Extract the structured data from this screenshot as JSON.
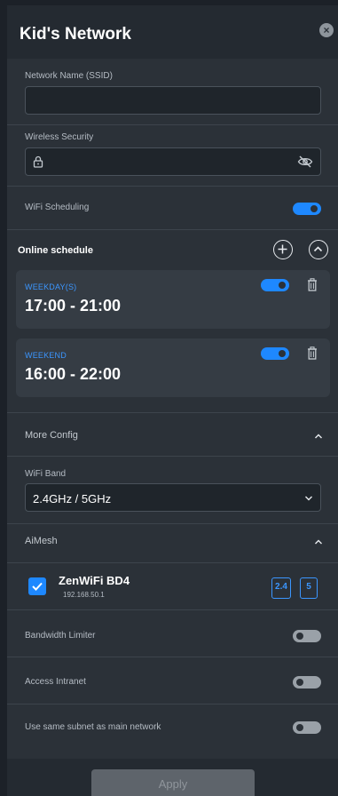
{
  "header": {
    "title": "Kid's Network",
    "close_glyph": "×"
  },
  "ssid": {
    "label": "Network Name (SSID)",
    "value": ""
  },
  "security": {
    "label": "Wireless Security",
    "value": ""
  },
  "wifi_scheduling": {
    "label": "WiFi Scheduling",
    "enabled": true
  },
  "online_schedule": {
    "title": "Online schedule",
    "items": [
      {
        "label": "WEEKDAY(S)",
        "time": "17:00 - 21:00",
        "enabled": true
      },
      {
        "label": "WEEKEND",
        "time": "16:00 - 22:00",
        "enabled": true
      }
    ]
  },
  "more_config": {
    "title": "More Config"
  },
  "wifi_band": {
    "label": "WiFi Band",
    "value": "2.4GHz / 5GHz"
  },
  "aimesh": {
    "title": "AiMesh",
    "node": {
      "name": "ZenWiFi BD4",
      "ip": "192.168.50.1",
      "checked": true,
      "bands": [
        "2.4",
        "5"
      ]
    }
  },
  "bandwidth_limiter": {
    "label": "Bandwidth Limiter",
    "enabled": false
  },
  "access_intranet": {
    "label": "Access Intranet",
    "enabled": false
  },
  "same_subnet": {
    "label": "Use same subnet as main network",
    "enabled": false
  },
  "apply": {
    "label": "Apply"
  },
  "colors": {
    "accent": "#1e88ff",
    "panel": "#2b3138",
    "disabled_button": "#5e646b"
  }
}
